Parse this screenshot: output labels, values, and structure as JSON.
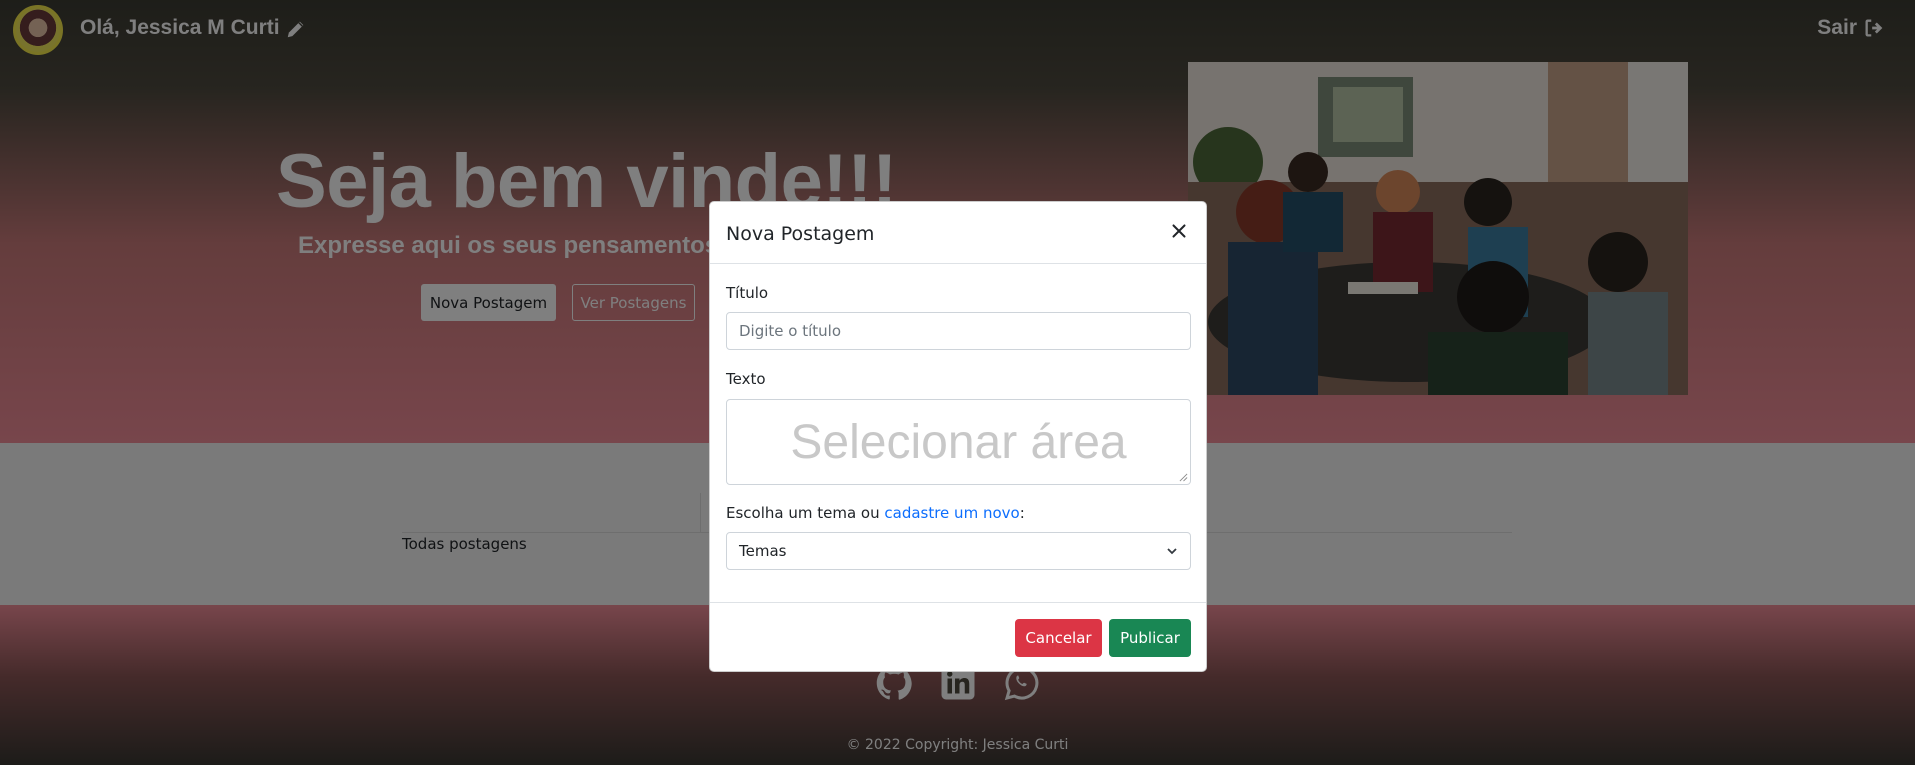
{
  "header": {
    "greeting": "Olá, Jessica M Curti",
    "logout_label": "Sair",
    "avatar_icon": "user-avatar",
    "edit_icon": "pencil-icon",
    "logout_icon": "sign-out-icon"
  },
  "hero": {
    "title": "Seja bem vinde!!!",
    "subtitle": "Expresse aqui os seus pensamentos e",
    "new_post_label": "Nova Postagem",
    "view_posts_label": "Ver Postagens",
    "photo": "team-meeting-photo"
  },
  "posts": {
    "tab_all": "Todas postagens"
  },
  "footer": {
    "social_icons": [
      "github-icon",
      "linkedin-icon",
      "whatsapp-icon"
    ],
    "copyright": "© 2022 Copyright: Jessica Curti"
  },
  "modal": {
    "title": "Nova Postagem",
    "title_label": "Título",
    "title_placeholder": "Digite o título",
    "text_label": "Texto",
    "text_overlay": "Selecionar área",
    "theme_label_prefix": "Escolha um tema ou ",
    "theme_link": "cadastre um novo",
    "theme_label_suffix": ":",
    "theme_selected": "Temas",
    "cancel_label": "Cancelar",
    "publish_label": "Publicar"
  },
  "colors": {
    "cancel": "#dc3545",
    "publish": "#198754",
    "link": "#0d6efd",
    "hero_pink": "#f08c98"
  }
}
